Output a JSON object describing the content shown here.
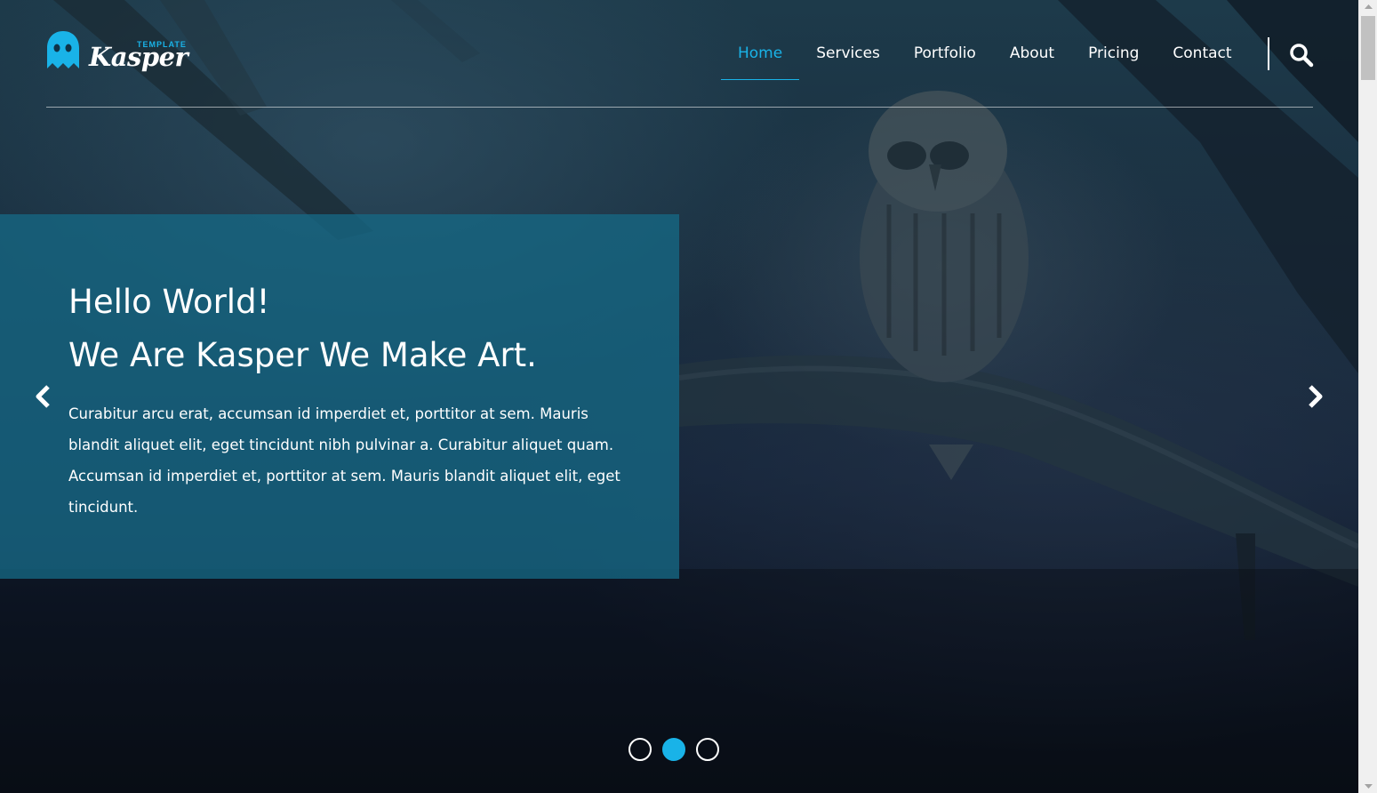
{
  "logo": {
    "name": "Kasper",
    "tag": "TEMPLATE",
    "brand_color": "#19b3e8"
  },
  "nav": {
    "items": [
      {
        "label": "Home",
        "active": true
      },
      {
        "label": "Services",
        "active": false
      },
      {
        "label": "Portfolio",
        "active": false
      },
      {
        "label": "About",
        "active": false
      },
      {
        "label": "Pricing",
        "active": false
      },
      {
        "label": "Contact",
        "active": false
      }
    ],
    "search_icon": "search-icon"
  },
  "hero": {
    "title_line1": "Hello World!",
    "title_line2": "We Are Kasper We Make Art.",
    "description": "Curabitur arcu erat, accumsan id imperdiet et, porttitor at sem. Mauris blandit aliquet elit, eget tincidunt nibh pulvinar a. Curabitur aliquet quam. Accumsan id imperdiet et, porttitor at sem. Mauris blandit aliquet elit, eget tincidunt.",
    "box_color": "#166884",
    "prev_icon": "chevron-left-icon",
    "next_icon": "chevron-right-icon"
  },
  "slider": {
    "slide_count": 3,
    "active_index": 1
  }
}
